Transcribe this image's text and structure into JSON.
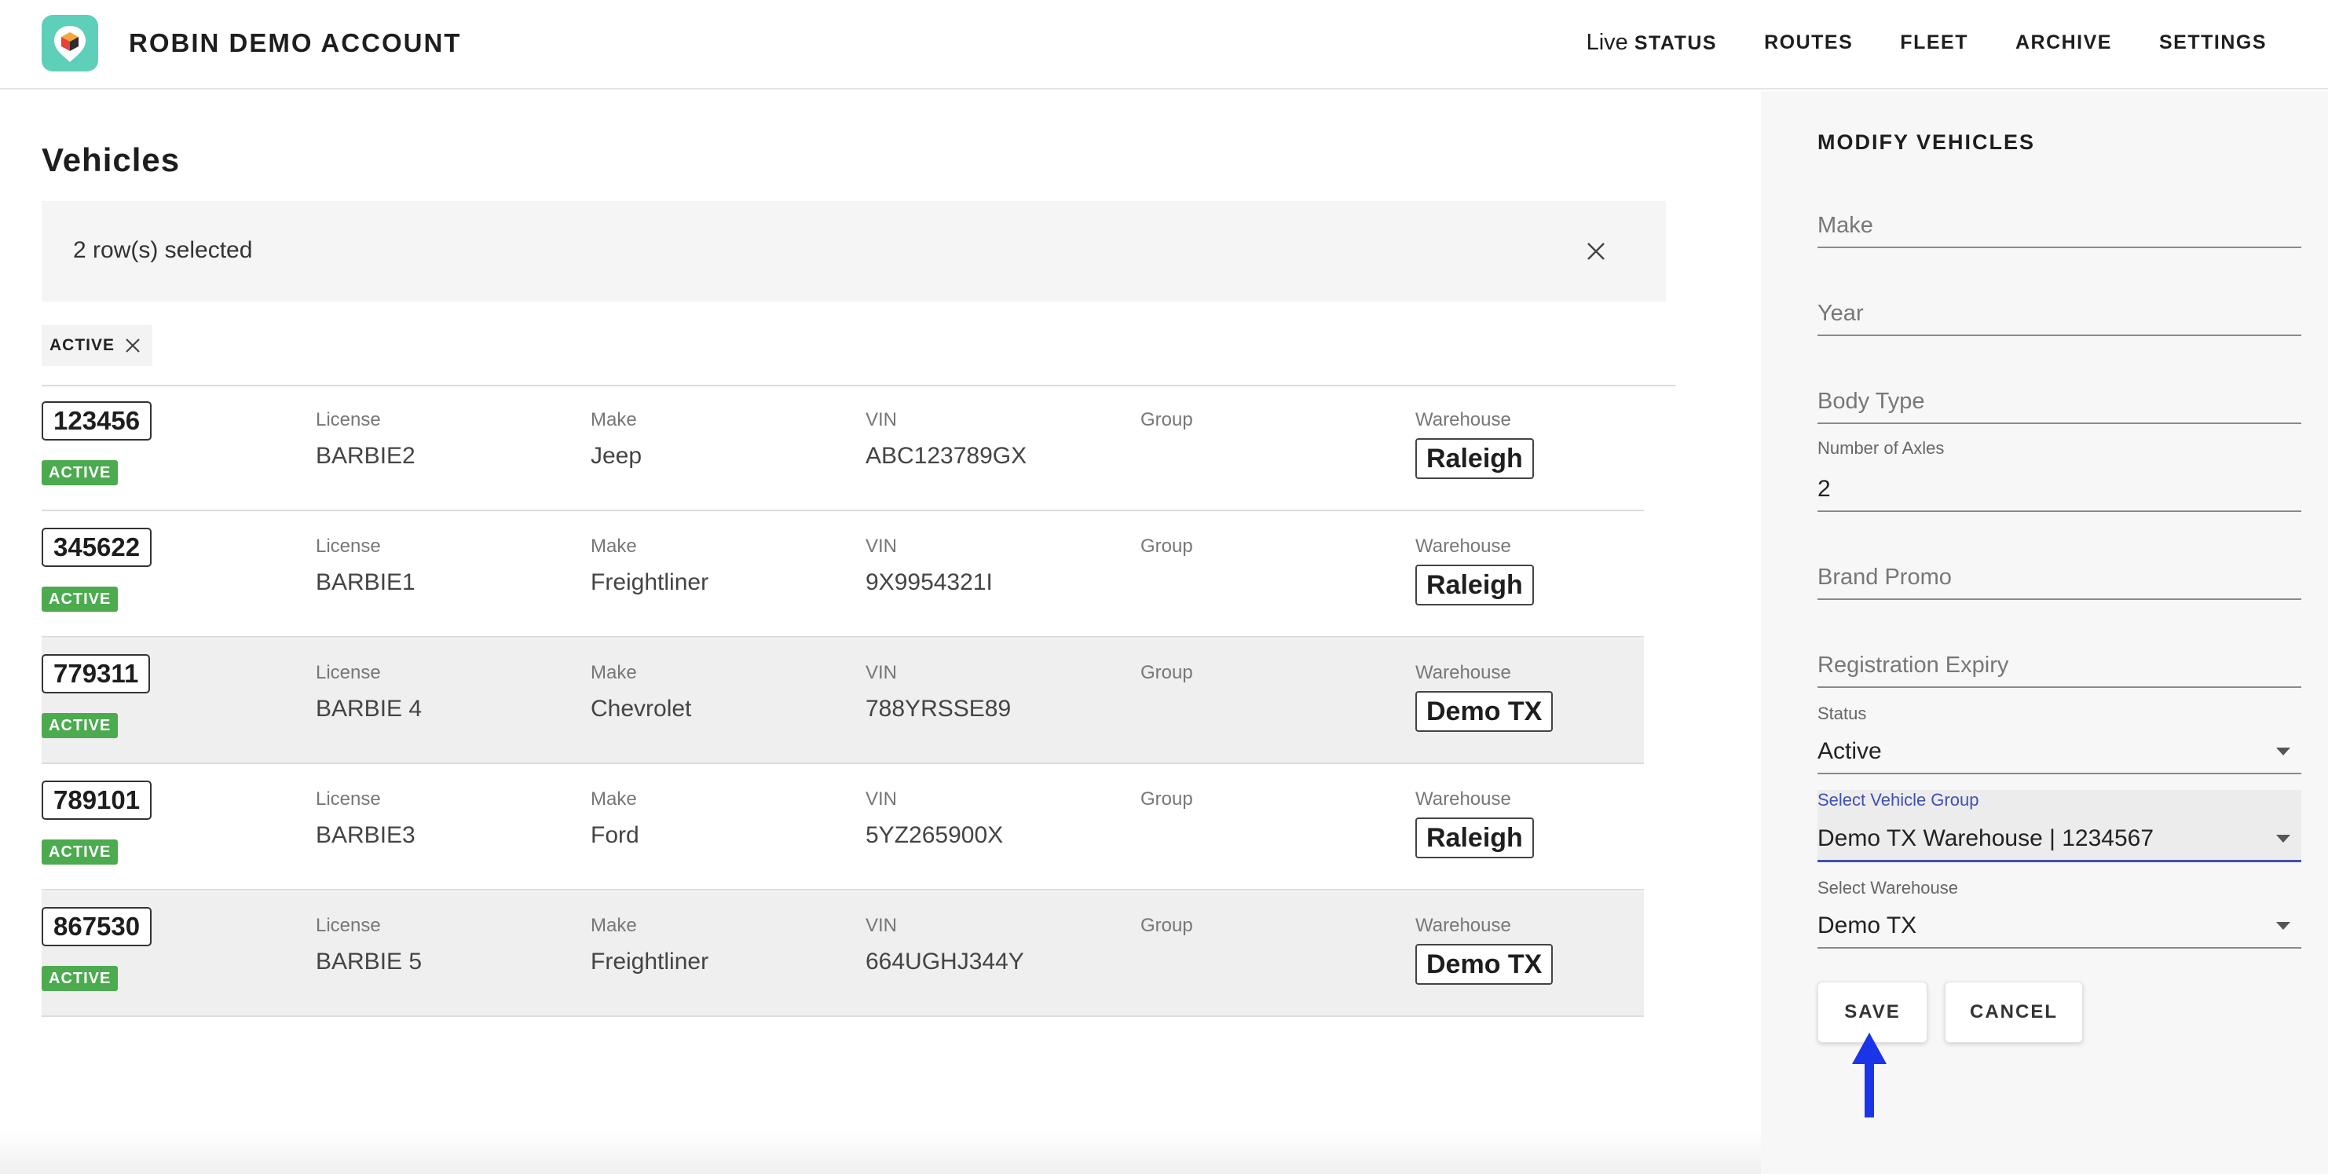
{
  "header": {
    "account_name": "ROBIN DEMO ACCOUNT",
    "nav": {
      "live_prefix": "Live",
      "status": "STATUS",
      "routes": "ROUTES",
      "fleet": "FLEET",
      "archive": "ARCHIVE",
      "settings": "SETTINGS"
    }
  },
  "main": {
    "title": "Vehicles",
    "selection_text": "2 row(s) selected",
    "filter_chip": "ACTIVE",
    "column_labels": {
      "license": "License",
      "make": "Make",
      "vin": "VIN",
      "group": "Group",
      "warehouse": "Warehouse"
    },
    "rows": [
      {
        "id": "123456",
        "status": "ACTIVE",
        "license": "BARBIE2",
        "make": "Jeep",
        "vin": "ABC123789GX",
        "group": "",
        "warehouse": "Raleigh"
      },
      {
        "id": "345622",
        "status": "ACTIVE",
        "license": "BARBIE1",
        "make": "Freightliner",
        "vin": "9X9954321I",
        "group": "",
        "warehouse": "Raleigh"
      },
      {
        "id": "779311",
        "status": "ACTIVE",
        "license": "BARBIE 4",
        "make": "Chevrolet",
        "vin": "788YRSSE89",
        "group": "",
        "warehouse": "Demo TX"
      },
      {
        "id": "789101",
        "status": "ACTIVE",
        "license": "BARBIE3",
        "make": "Ford",
        "vin": "5YZ265900X",
        "group": "",
        "warehouse": "Raleigh"
      },
      {
        "id": "867530",
        "status": "ACTIVE",
        "license": "BARBIE 5",
        "make": "Freightliner",
        "vin": "664UGHJ344Y",
        "group": "",
        "warehouse": "Demo TX"
      }
    ]
  },
  "panel": {
    "title": "MODIFY VEHICLES",
    "make_placeholder": "Make",
    "year_placeholder": "Year",
    "body_type_placeholder": "Body Type",
    "axles_label": "Number of Axles",
    "axles_value": "2",
    "brand_promo_placeholder": "Brand Promo",
    "registration_placeholder": "Registration Expiry",
    "status_label": "Status",
    "status_value": "Active",
    "vehicle_group_label": "Select Vehicle Group",
    "vehicle_group_value": "Demo TX Warehouse | 1234567",
    "warehouse_label": "Select Warehouse",
    "warehouse_value": "Demo TX",
    "save_label": "SAVE",
    "cancel_label": "CANCEL"
  },
  "colors": {
    "active_badge": "#4caa4f",
    "logo_bg": "#5ecfb8",
    "focus_underline": "#3f51b5",
    "pointer_arrow": "#1a35e8"
  },
  "icons": [
    "app-logo-icon",
    "close-icon",
    "chip-close-icon",
    "dropdown-caret-icon",
    "pointer-arrow-icon"
  ]
}
